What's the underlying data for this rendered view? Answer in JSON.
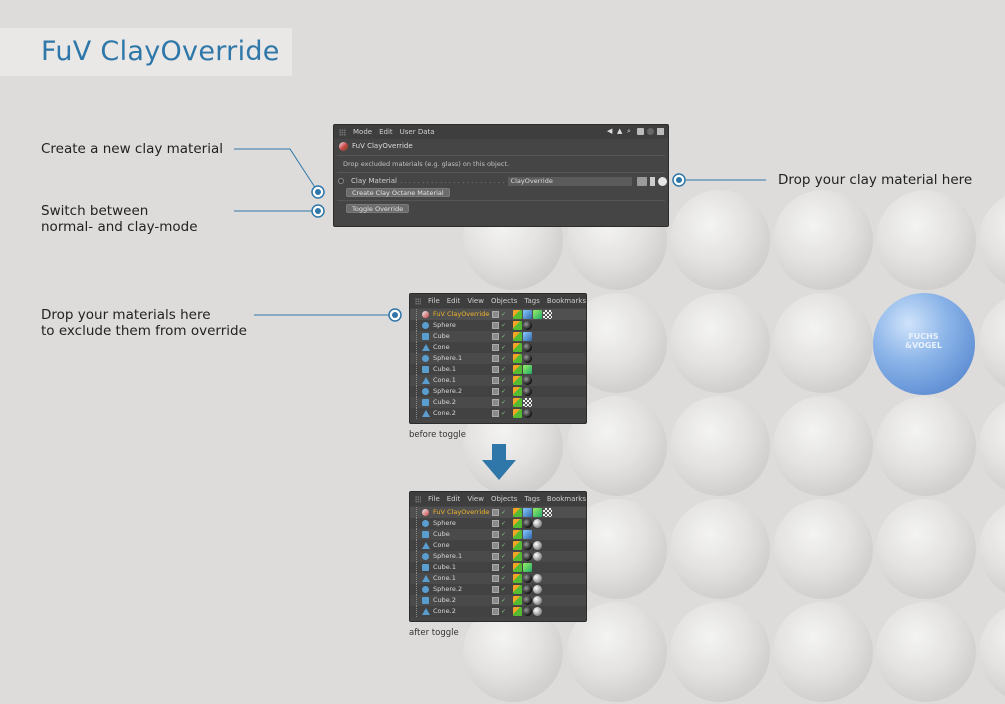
{
  "page": {
    "title": "FuV ClayOverride"
  },
  "callouts": {
    "create": "Create a new clay material",
    "switch_line1": "Switch between",
    "switch_line2": "normal- and clay-mode",
    "drop_clay": "Drop your clay material here",
    "drop_mats_line1": "Drop your materials here",
    "drop_mats_line2": "to exclude them from override"
  },
  "attr_panel": {
    "menu": [
      "Mode",
      "Edit",
      "User Data"
    ],
    "object_name": "FuV ClayOverride",
    "description": "Drop excluded materials (e.g. glass) on this object.",
    "field_label": "Clay Material",
    "field_dots": ". . . . . . . . . . . . . . . . . . . . . . . .",
    "field_value": "ClayOverride",
    "button_create": "Create Clay Octane Material",
    "button_toggle": "Toggle Override"
  },
  "object_manager": {
    "menu": [
      "File",
      "Edit",
      "View",
      "Objects",
      "Tags",
      "Bookmarks"
    ],
    "before": {
      "caption": "before toggle",
      "rows": [
        {
          "name": "FuV ClayOverride",
          "icon": "override",
          "tags": [
            "phong",
            "blue",
            "green",
            "checker"
          ]
        },
        {
          "name": "Sphere",
          "icon": "sphere",
          "tags": [
            "phong",
            "mat"
          ]
        },
        {
          "name": "Cube",
          "icon": "cube",
          "tags": [
            "phong",
            "blue"
          ]
        },
        {
          "name": "Cone",
          "icon": "cone",
          "tags": [
            "phong",
            "mat"
          ]
        },
        {
          "name": "Sphere.1",
          "icon": "sphere",
          "tags": [
            "phong",
            "mat"
          ]
        },
        {
          "name": "Cube.1",
          "icon": "cube",
          "tags": [
            "phong",
            "green"
          ]
        },
        {
          "name": "Cone.1",
          "icon": "cone",
          "tags": [
            "phong",
            "mat"
          ]
        },
        {
          "name": "Sphere.2",
          "icon": "sphere",
          "tags": [
            "phong",
            "mat"
          ]
        },
        {
          "name": "Cube.2",
          "icon": "cube",
          "tags": [
            "phong",
            "checker"
          ]
        },
        {
          "name": "Cone.2",
          "icon": "cone",
          "tags": [
            "phong",
            "mat"
          ]
        }
      ]
    },
    "after": {
      "caption": "after toggle",
      "rows": [
        {
          "name": "FuV ClayOverride",
          "icon": "override",
          "tags": [
            "phong",
            "blue",
            "green",
            "checker"
          ]
        },
        {
          "name": "Sphere",
          "icon": "sphere",
          "tags": [
            "phong",
            "mat",
            "gray"
          ]
        },
        {
          "name": "Cube",
          "icon": "cube",
          "tags": [
            "phong",
            "blue"
          ]
        },
        {
          "name": "Cone",
          "icon": "cone",
          "tags": [
            "phong",
            "mat",
            "gray"
          ]
        },
        {
          "name": "Sphere.1",
          "icon": "sphere",
          "tags": [
            "phong",
            "mat",
            "gray"
          ]
        },
        {
          "name": "Cube.1",
          "icon": "cube",
          "tags": [
            "phong",
            "green"
          ]
        },
        {
          "name": "Cone.1",
          "icon": "cone",
          "tags": [
            "phong",
            "mat",
            "gray"
          ]
        },
        {
          "name": "Sphere.2",
          "icon": "sphere",
          "tags": [
            "phong",
            "mat",
            "gray"
          ]
        },
        {
          "name": "Cube.2",
          "icon": "cube",
          "tags": [
            "phong",
            "mat",
            "gray"
          ]
        },
        {
          "name": "Cone.2",
          "icon": "cone",
          "tags": [
            "phong",
            "mat",
            "gray"
          ]
        }
      ]
    }
  },
  "logo": {
    "line1": "FUCHS",
    "line2": "&VOGEL"
  },
  "colors": {
    "accent": "#2e77a8",
    "background": "#dddcda",
    "panel": "#454545",
    "highlight_name": "#f0b428"
  }
}
